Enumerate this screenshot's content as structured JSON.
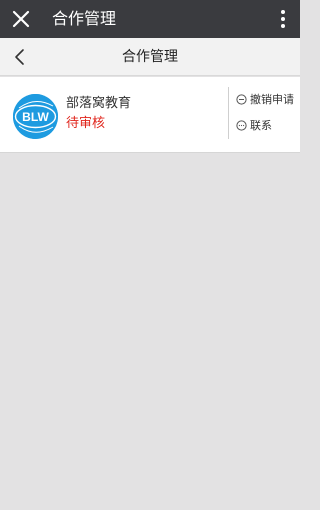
{
  "topbar": {
    "title": "合作管理"
  },
  "subbar": {
    "title": "合作管理"
  },
  "item": {
    "org_name": "部落窝教育",
    "status": "待审核",
    "logo_text": "BLW",
    "actions": {
      "revoke": "撤销申请",
      "contact": "联系"
    }
  },
  "icons": {
    "close": "close-icon",
    "more": "more-vertical-icon",
    "back": "chevron-left-icon",
    "revoke": "minus-circle-icon",
    "contact": "ellipsis-circle-icon"
  },
  "colors": {
    "topbar_bg": "#3a3b3f",
    "status_red": "#e0251c",
    "logo_blue": "#1e9be0",
    "page_bg": "#e3e2e3"
  }
}
